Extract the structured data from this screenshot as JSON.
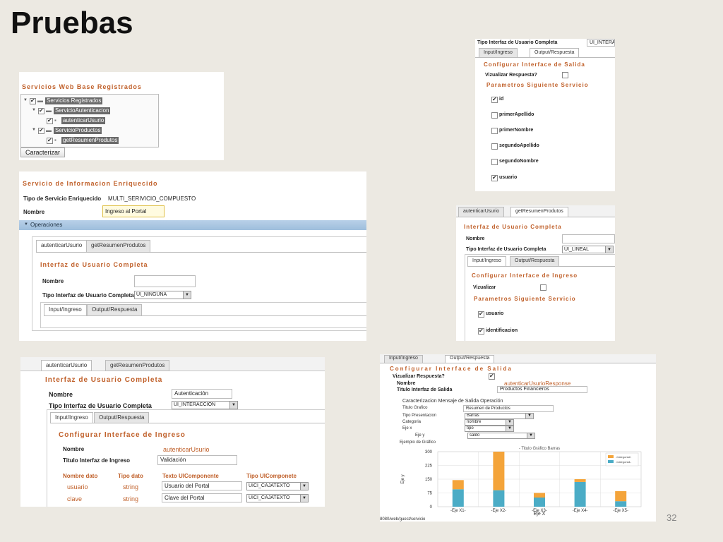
{
  "slide": {
    "title": "Pruebas",
    "page_number": "32"
  },
  "shot1": {
    "heading": "Servicios Web Base Registrados",
    "tree": [
      {
        "label": "Servicios Registrados",
        "level": 0
      },
      {
        "label": "ServicioAutenticacion",
        "level": 1
      },
      {
        "label": "autenticarUsurio",
        "level": 2
      },
      {
        "label": "ServicioProductos",
        "level": 1
      },
      {
        "label": "getResumenProdutos",
        "level": 2
      }
    ],
    "button": "Caracterizar"
  },
  "shot2": {
    "heading": "Servicio de Informacion Enriquecido",
    "tipo_label": "Tipo de Servicio Enriquecido",
    "tipo_value": "MULTI_SERIVICIO_COMPUESTO",
    "nombre_label": "Nombre",
    "nombre_value": "Ingreso al Portal",
    "operaciones": "Operaciones",
    "tabs": [
      "autenticarUsurio",
      "getResumenProdutos"
    ],
    "interfaz_heading": "Interfaz de Usuario Completa",
    "nombre2_label": "Nombre",
    "tipo_interfaz_label": "Tipo Interfaz de Usuario Completa",
    "tipo_interfaz_value": "UI_NINGUNA",
    "subtabs": [
      "Input/Ingreso",
      "Output/Respuesta"
    ]
  },
  "shot3": {
    "tabs": [
      "autenticarUsurio",
      "getResumenProdutos"
    ],
    "heading": "Interfaz de Usuario Completa",
    "nombre_label": "Nombre",
    "nombre_value": "Autenticación",
    "tipo_label": "Tipo Interfaz de Usuario Completa",
    "tipo_value": "UI_INTERACCION",
    "subtabs": [
      "Input/Ingreso",
      "Output/Respuesta"
    ],
    "config_heading": "Configurar Interface de Ingreso",
    "nombre2_label": "Nombre",
    "nombre2_value": "autenticarUsurio",
    "titulo_label": "Titulo Interfaz de Ingreso",
    "titulo_value": "Validación",
    "columns": [
      "Nombre dato",
      "Tipo dato",
      "Texto UIComponente",
      "Tipo UIComponete"
    ],
    "rows": [
      {
        "nombre": "usuario",
        "tipo": "string",
        "texto": "Usuario del Portal",
        "comp": "UICI_CAJATEXTO"
      },
      {
        "nombre": "clave",
        "tipo": "string",
        "texto": "Clave del Portal",
        "comp": "UICI_CAJATEXTO"
      }
    ]
  },
  "shot4": {
    "tipo_label": "Tipo Interfaz de Usuario Completa",
    "tipo_value": "UI_INTERA",
    "tabs": [
      "Input/Ingreso",
      "Output/Respuesta"
    ],
    "config_heading": "Configurar Interface de Salida",
    "visualizar_label": "Vizualizar Respuesta?",
    "params_heading": "Parametros Siguiente Servicio",
    "params": [
      {
        "label": "id",
        "checked": true
      },
      {
        "label": "primerApellido",
        "checked": false
      },
      {
        "label": "primerNombre",
        "checked": false
      },
      {
        "label": "segundoApellido",
        "checked": false
      },
      {
        "label": "segundoNombre",
        "checked": false
      },
      {
        "label": "usuario",
        "checked": true
      }
    ]
  },
  "shot5": {
    "tabs": [
      "autenticarUsurio",
      "getResumenProdutos"
    ],
    "heading": "Interfaz de Usuario Completa",
    "nombre_label": "Nombre",
    "tipo_label": "Tipo Interfaz de Usuario Completa",
    "tipo_value": "UI_LINEAL",
    "subtabs": [
      "Input/Ingreso",
      "Output/Respuesta"
    ],
    "config_heading": "Configurar Interface de Ingreso",
    "visualizar_label": "Vizualizar",
    "params_heading": "Parametros Siguiente Servicio",
    "params": [
      {
        "label": "usuario",
        "checked": true
      },
      {
        "label": "identificacion",
        "checked": true
      }
    ]
  },
  "shot6": {
    "tabs": [
      "Input/Ingreso",
      "Output/Respuesta"
    ],
    "config_heading": "Configurar Interface de Salida",
    "visualizar_label": "Vizualizar Respuesta?",
    "nombre_label": "Nombre",
    "nombre_value": "autenticarUsurioResponse",
    "titulo_label": "Titulo Interfaz de Salida",
    "titulo_value": "Productos Financieros",
    "caract_label": "Caracterizacion Mensaje de Salida Operación",
    "fields": [
      {
        "label": "Titulo Grafico",
        "value": "Resumen de Productos"
      },
      {
        "label": "Tipo Presentacion",
        "value": "Barras"
      },
      {
        "label": "Categoria",
        "value": "nombre"
      },
      {
        "label": "Eje x",
        "value": "tipo"
      },
      {
        "label": "Eje y",
        "value": "saldo"
      }
    ],
    "ejemplo_label": "Ejemplo de Gráfico",
    "url": "8080/web/guest/servicio"
  },
  "chart_data": {
    "type": "bar",
    "title": "- Titulo Gráfico Barras",
    "categories": [
      "-Eje X1-",
      "-Eje X2-",
      "-Eje X3-",
      "-Eje X4-",
      "-Eje X5-"
    ],
    "series": [
      {
        "name": "-Categoria1-",
        "values": [
          95,
          90,
          50,
          135,
          30
        ],
        "color": "#4bacc6"
      },
      {
        "name": "-Categoria2-",
        "values": [
          50,
          210,
          25,
          15,
          55
        ],
        "color": "#f4a43a"
      }
    ],
    "ylabel": "Eje y",
    "xlabel": "Eje X",
    "yticks": [
      0,
      75,
      150,
      225,
      300
    ],
    "ylim": [
      0,
      300
    ],
    "grid": true,
    "legend": "top-right"
  }
}
